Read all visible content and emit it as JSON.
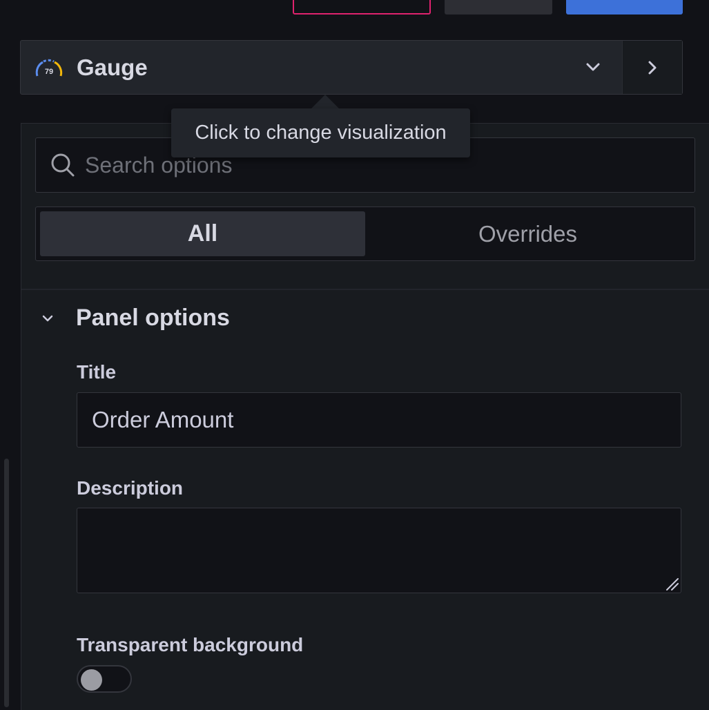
{
  "header": {
    "discard_label": "",
    "save_label": "",
    "apply_label": ""
  },
  "visualization": {
    "name": "Gauge",
    "icon": "gauge-icon",
    "gauge_icon_value": "79"
  },
  "tooltip": {
    "text": "Click to change visualization"
  },
  "search": {
    "placeholder": "Search options",
    "value": ""
  },
  "tabs": [
    {
      "label": "All",
      "active": true
    },
    {
      "label": "Overrides",
      "active": false
    }
  ],
  "panel_options": {
    "section_title": "Panel options",
    "title_label": "Title",
    "title_value": "Order Amount",
    "description_label": "Description",
    "description_value": "",
    "transparent_label": "Transparent background",
    "transparent_enabled": false
  },
  "colors": {
    "background": "#111217",
    "panel": "#181b1f",
    "accent_blue": "#3d71d9",
    "accent_pink": "#e0226e"
  }
}
